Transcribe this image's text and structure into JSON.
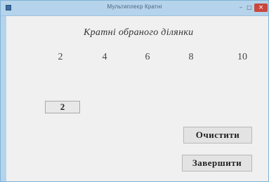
{
  "window": {
    "title": "Мультиплеєр Кратні",
    "minimize_glyph": "–",
    "maximize_glyph": "□",
    "close_glyph": "×"
  },
  "main": {
    "heading": "Кратні обраного ділянки",
    "multiples": [
      "2",
      "4",
      "6",
      "8",
      "10"
    ],
    "input_value": "2",
    "clear_button_label": "Очистити",
    "exit_button_label": "Завершити"
  },
  "colors": {
    "titlebar": "#b5d3ea",
    "close_button": "#c9463d",
    "window_background": "#f0f0f0"
  }
}
